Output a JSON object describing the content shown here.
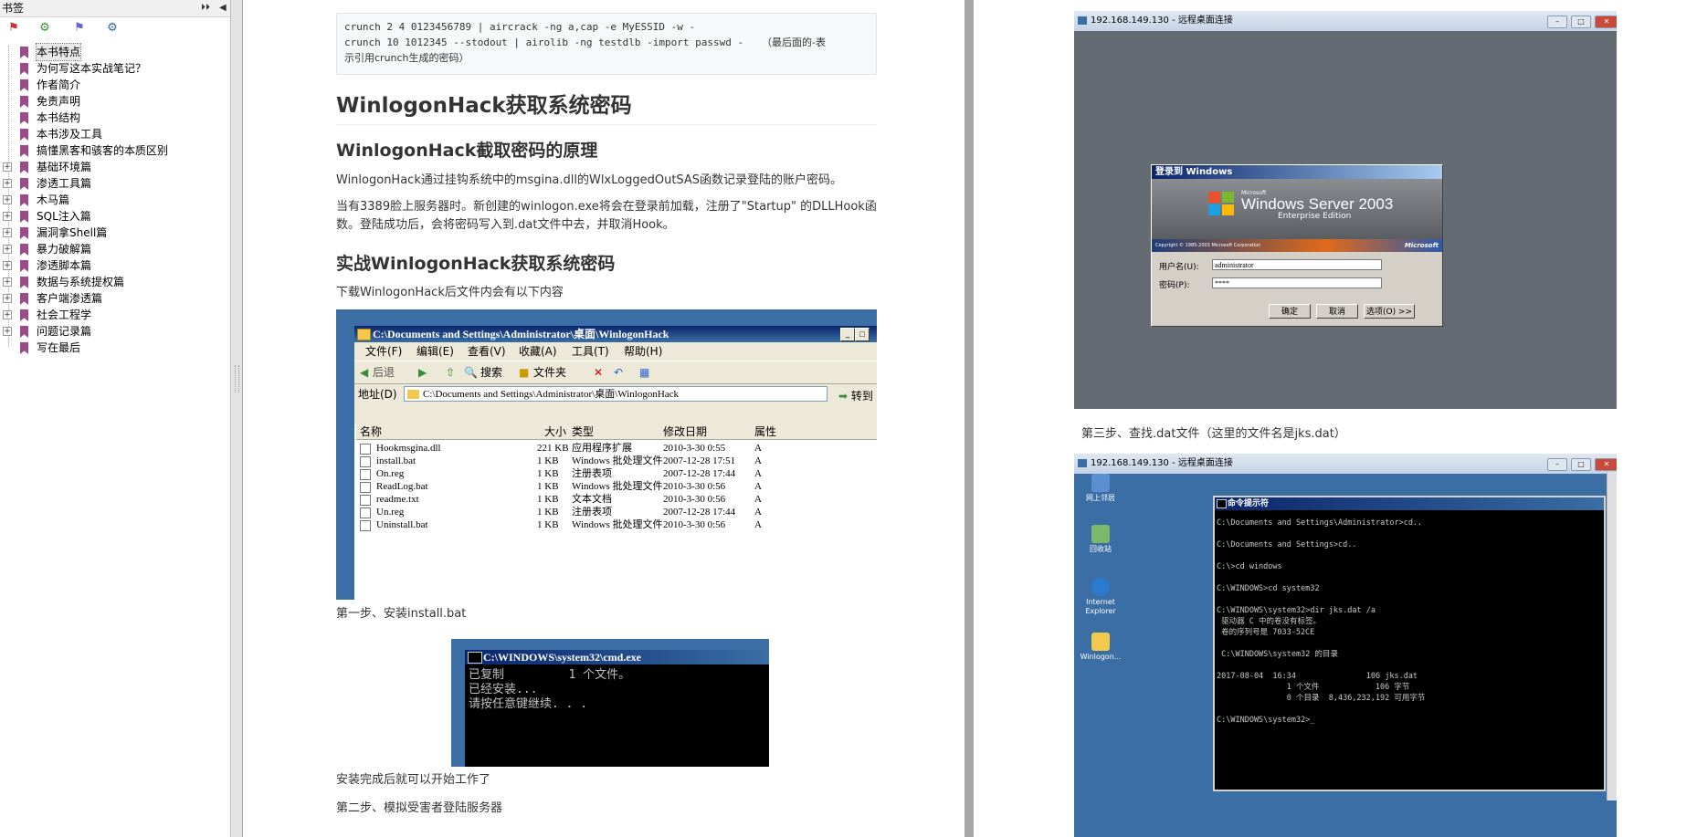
{
  "sidebar": {
    "title": "书签",
    "items": [
      {
        "label": "本书特点",
        "expandable": false,
        "selected": true
      },
      {
        "label": "为何写这本实战笔记？",
        "expandable": false
      },
      {
        "label": "作者简介",
        "expandable": false
      },
      {
        "label": "免责声明",
        "expandable": false
      },
      {
        "label": "本书结构",
        "expandable": false
      },
      {
        "label": "本书涉及工具",
        "expandable": false
      },
      {
        "label": "搞懂黑客和骇客的本质区别",
        "expandable": false
      },
      {
        "label": "基础环境篇",
        "expandable": true
      },
      {
        "label": "渗透工具篇",
        "expandable": true
      },
      {
        "label": "木马篇",
        "expandable": true
      },
      {
        "label": "SQL注入篇",
        "expandable": true
      },
      {
        "label": "漏洞拿Shell篇",
        "expandable": true
      },
      {
        "label": "暴力破解篇",
        "expandable": true
      },
      {
        "label": "渗透脚本篇",
        "expandable": true
      },
      {
        "label": "数据与系统提权篇",
        "expandable": true
      },
      {
        "label": "客户端渗透篇",
        "expandable": true
      },
      {
        "label": "社会工程学",
        "expandable": true
      },
      {
        "label": "问题记录篇",
        "expandable": true
      },
      {
        "label": "写在最后",
        "expandable": false
      }
    ]
  },
  "page1": {
    "code_line1": "crunch 2 4 0123456789 | aircrack -ng a,cap -e MyESSID -w -",
    "code_line2": "crunch 10 1012345 --stodout | airolib -ng testdlb -import passwd -",
    "code_tail": "（最后面的-表",
    "code_line3": "示引用crunch生成的密码）",
    "h1": "WinlogonHack获取系统密码",
    "h2_principle": "WinlogonHack截取密码的原理",
    "para1": "WinlogonHack通过挂钩系统中的msgina.dll的WlxLoggedOutSAS函数记录登陆的账户密码。",
    "para2": "当有3389脸上服务器时。新创建的winlogon.exe将会在登录前加载，注册了\"Startup\" 的DLLHook函数。登陆成功后，会将密码写入到.dat文件中去，并取消Hook。",
    "h2_practice": "实战WinlogonHack获取系统密码",
    "para3": "下载WinlogonHack后文件内会有以下内容",
    "step1": "第一步、安装install.bat",
    "after_install": "安装完成后就可以开始工作了",
    "step2": "第二步、模拟受害者登陆服务器"
  },
  "explorer": {
    "title": "C:\\Documents and Settings\\Administrator\\桌面\\WinlogonHack",
    "menu": [
      "文件(F)",
      "编辑(E)",
      "查看(V)",
      "收藏(A)",
      "工具(T)",
      "帮助(H)"
    ],
    "toolbar": {
      "back": "后退",
      "search": "搜索",
      "folders": "文件夹"
    },
    "address_label": "地址(D)",
    "address": "C:\\Documents and Settings\\Administrator\\桌面\\WinlogonHack",
    "go": "转到",
    "columns": [
      "名称",
      "大小",
      "类型",
      "修改日期",
      "属性"
    ],
    "files": [
      {
        "name": "Hookmsgina.dll",
        "size": "221 KB",
        "type": "应用程序扩展",
        "date": "2010-3-30 0:55",
        "attr": "A"
      },
      {
        "name": "install.bat",
        "size": "1 KB",
        "type": "Windows 批处理文件",
        "date": "2007-12-28 17:51",
        "attr": "A"
      },
      {
        "name": "On.reg",
        "size": "1 KB",
        "type": "注册表项",
        "date": "2007-12-28 17:44",
        "attr": "A"
      },
      {
        "name": "ReadLog.bat",
        "size": "1 KB",
        "type": "Windows 批处理文件",
        "date": "2010-3-30 0:56",
        "attr": "A"
      },
      {
        "name": "readme.txt",
        "size": "1 KB",
        "type": "文本文档",
        "date": "2010-3-30 0:56",
        "attr": "A"
      },
      {
        "name": "Un.reg",
        "size": "1 KB",
        "type": "注册表项",
        "date": "2007-12-28 17:44",
        "attr": "A"
      },
      {
        "name": "Uninstall.bat",
        "size": "1 KB",
        "type": "Windows 批处理文件",
        "date": "2010-3-30 0:56",
        "attr": "A"
      }
    ]
  },
  "cmd1": {
    "title": "C:\\WINDOWS\\system32\\cmd.exe",
    "lines": [
      "已复制         1 个文件。",
      "已经安装...",
      "请按任意键继续. . ."
    ]
  },
  "page2": {
    "step3": "第三步、查找.dat文件（这里的文件名是jks.dat）"
  },
  "rdp1": {
    "title": "192.168.149.130 - 远程桌面连接",
    "dialog_title": "登录到 Windows",
    "brand_small": "Microsoft",
    "brand": "Windows Server 2003",
    "edition": "Enterprise Edition",
    "copyright": "Copyright © 1985-2003  Microsoft Corporation",
    "ms_logo": "Microsoft",
    "user_label": "用户名(U):",
    "user_value": "administrator",
    "pass_label": "密码(P):",
    "pass_value": "****",
    "ok": "确定",
    "cancel": "取消",
    "options": "选项(O) >>"
  },
  "rdp2": {
    "title": "192.168.149.130 - 远程桌面连接",
    "desktop_icons": [
      "网上邻居",
      "回收站",
      "Internet Explorer",
      "Winlogon..."
    ],
    "cmd_title": "命令提示符",
    "cmd_lines": [
      "C:\\Documents and Settings\\Administrator>cd..",
      "",
      "C:\\Documents and Settings>cd..",
      "",
      "C:\\>cd windows",
      "",
      "C:\\WINDOWS>cd system32",
      "",
      "C:\\WINDOWS\\system32>dir jks.dat /a",
      " 驱动器 C 中的卷没有标签。",
      " 卷的序列号是 7033-52CE",
      "",
      " C:\\WINDOWS\\system32 的目录",
      "",
      "2017-08-04  16:34               106 jks.dat",
      "               1 个文件            106 字节",
      "               0 个目录  8,436,232,192 可用字节",
      "",
      "C:\\WINDOWS\\system32>_"
    ]
  },
  "colors": {
    "bookmark": "#9a4c8a",
    "xp_blue": "#3a6ea5",
    "title_dark": "#0a246a"
  }
}
